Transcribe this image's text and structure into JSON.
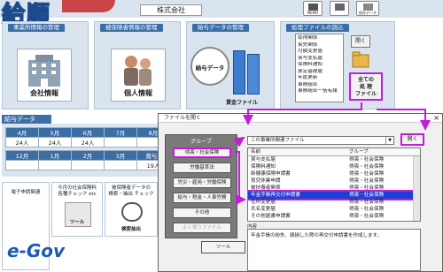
{
  "app": {
    "logo_text": "給順",
    "company_suffix": "株式会社"
  },
  "toolbar": {
    "icons": [
      {
        "label": "MEMO",
        "icon": "memo-icon"
      },
      {
        "label": "",
        "icon": "printer-icon"
      },
      {
        "label": "保存データ",
        "icon": "save-data-icon"
      }
    ]
  },
  "panels": {
    "office": {
      "title": "事業所情報の管理",
      "card_label": "会社情報"
    },
    "insured": {
      "title": "被保険者情報の管理",
      "card_label": "個人情報"
    },
    "salary_mgmt": {
      "title": "給与データの管理",
      "card_label": "給与データ",
      "ledger_label": "賃金ファイル"
    },
    "processing": {
      "title": "処理ファイルの読込",
      "files": [
        "取得関係",
        "喪失関係",
        "月額変更届",
        "賞与支払届",
        "保険料通知",
        "算定基礎届",
        "年度更新",
        "事務組合",
        "事務組合一括有報"
      ],
      "open_button": "開く",
      "all_files_button": [
        "全ての",
        "処 理",
        "ファイル"
      ]
    }
  },
  "salary_data": {
    "title": "給与データ",
    "rows": [
      {
        "months": [
          "4月",
          "5月",
          "6月",
          "7月",
          "8月"
        ],
        "counts": [
          "24人",
          "24人",
          "24人",
          "",
          ""
        ]
      },
      {
        "months": [
          "12月",
          "1月",
          "2月",
          "3月",
          "賞与1"
        ],
        "counts": [
          "",
          "",
          "",
          "",
          "19人"
        ]
      }
    ]
  },
  "bottom_links": {
    "e_application": "電子申請関連",
    "checks": [
      "今月の社会保険料",
      "各種チェック etc"
    ],
    "tool_label": "ツール",
    "insured_check": [
      "被保険者データの",
      "検索・抽出 チェック"
    ],
    "search_label": "検索抽出",
    "egov": "e-Gov"
  },
  "dialog": {
    "title": "ファイルを開く",
    "close": "×",
    "group_header": "グループ",
    "groups": [
      {
        "label": "得喪・社会保険",
        "selected": true
      },
      {
        "label": "労働基準法",
        "selected": false
      },
      {
        "label": "労災・雇用・労働保険",
        "selected": false
      },
      {
        "label": "給与・税金・人事労務",
        "selected": false
      },
      {
        "label": "その他",
        "selected": false
      },
      {
        "label": "よく使うファイル",
        "selected": false,
        "dim": true
      }
    ],
    "tool_button": "ツール",
    "file_combo": "この事業所関連ファイル",
    "open_button": "開く",
    "col_name": "名前",
    "col_group": "グループ",
    "files": [
      {
        "name": "賞与支払届",
        "group": "得喪・社会保険"
      },
      {
        "name": "保険料通知",
        "group": "得喪・社会保険"
      },
      {
        "name": "新健康保険申請書",
        "group": "得喪・社会保険"
      },
      {
        "name": "育児休業申請",
        "group": "得喪・社会保険"
      },
      {
        "name": "被扶養者関係",
        "group": "得喪・社会保険"
      },
      {
        "name": "年金手帳再交付申請書",
        "group": "得喪・社会保険",
        "selected": true
      },
      {
        "name": "住所変更届",
        "group": "得喪・社会保険"
      },
      {
        "name": "氏名変更届",
        "group": "得喪・社会保険"
      },
      {
        "name": "その他届書申請書",
        "group": "得喪・社会保険"
      }
    ],
    "content_label": "内容",
    "content_text": "年金手帳の紛失、毀損した際の再交付申請書を作成します。"
  },
  "colors": {
    "accent": "#3b6ea5",
    "panel_bg": "#d9e4ee",
    "highlight": "#c21ed6",
    "selection": "#1e3fd6"
  }
}
